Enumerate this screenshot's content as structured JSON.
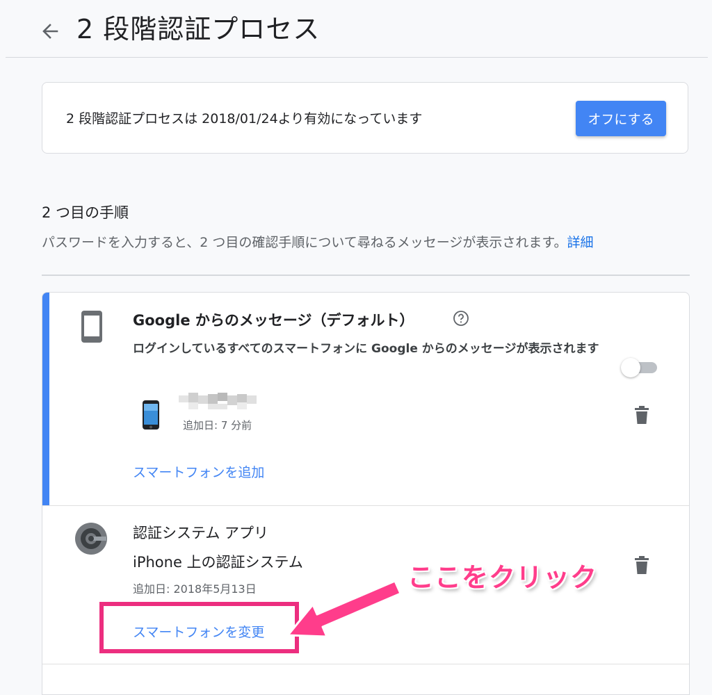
{
  "header": {
    "title": "2 段階認証プロセス",
    "back_icon": "arrow-back-icon"
  },
  "status": {
    "text": "2 段階認証プロセスは 2018/01/24より有効になっています",
    "turn_off_label": "オフにする"
  },
  "second_step": {
    "title": "2 つ目の手順",
    "description": "パスワードを入力すると、2 つ目の確認手順について尋ねるメッセージが表示されます。",
    "learn_more": "詳細"
  },
  "google_prompt": {
    "title_prefix": "Google からのメッセージ",
    "title_suffix": "（デフォルト）",
    "description": "ログインしているすべてのスマートフォンに Google からのメッセージが表示されます",
    "toggle_on": false,
    "device": {
      "added": "追加日: 7 分前"
    },
    "add_phone_label": "スマートフォンを追加"
  },
  "authenticator": {
    "title": "認証システム アプリ",
    "subtitle": "iPhone 上の認証システム",
    "added": "追加日: 2018年5月13日",
    "change_phone_label": "スマートフォンを変更"
  },
  "annotation": {
    "callout": "ここをクリック",
    "color": "#ec2e7f"
  },
  "colors": {
    "accent": "#4285f4",
    "link": "#4285f4",
    "highlight": "#ec2e7f"
  }
}
